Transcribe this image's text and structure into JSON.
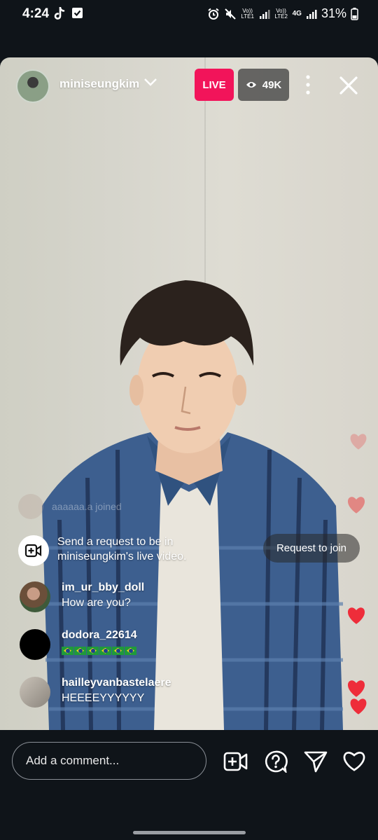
{
  "status_bar": {
    "time": "4:24",
    "volte1": "Vo)) LTE1",
    "volte2": "Vo)) LTE2",
    "network": "4G",
    "battery": "31%"
  },
  "live": {
    "username": "miniseungkim",
    "live_label": "LIVE",
    "viewer_count": "49K",
    "faded_comment": "aaaaaa.a joined"
  },
  "request": {
    "text": "Send a request to be in miniseungkim's live video.",
    "button": "Request to join"
  },
  "comments": [
    {
      "username": "im_ur_bby_doll",
      "text": "How are you?",
      "avatar_color": "#5a4a3a"
    },
    {
      "username": "dodora_22614",
      "text": "",
      "flags": 6,
      "avatar_color": "#000000"
    },
    {
      "username": "hailleyvanbastelaere",
      "text": "HEEEEYYYYYY",
      "avatar_color": "#a8a29a"
    }
  ],
  "composer": {
    "placeholder": "Add a comment..."
  },
  "colors": {
    "live_red": "#f2145a",
    "background": "#0f1419"
  }
}
